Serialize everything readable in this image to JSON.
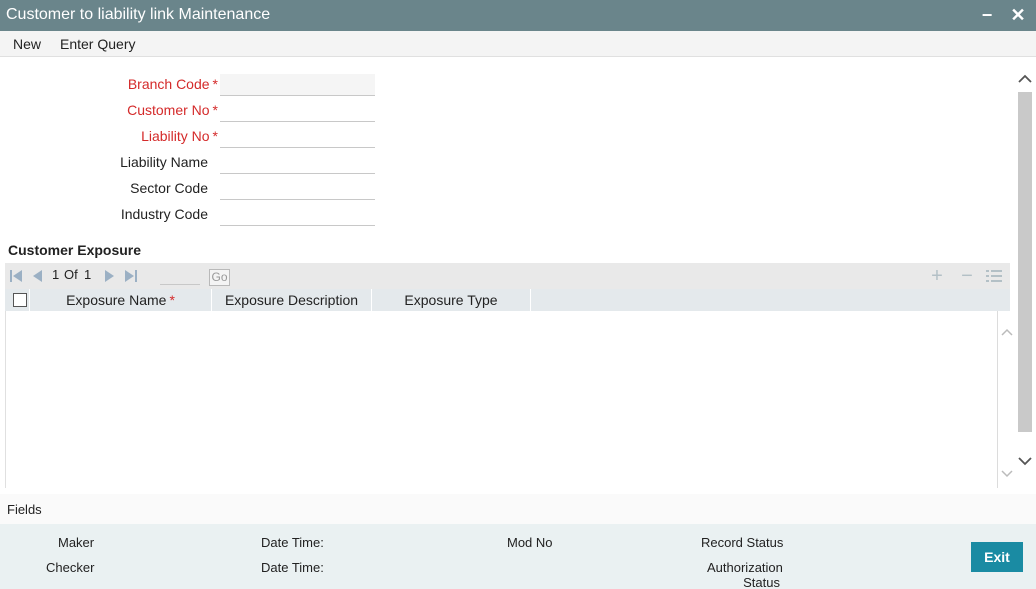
{
  "window": {
    "title": "Customer to liability link Maintenance",
    "minimize_symbol": "−",
    "close_symbol": "✕"
  },
  "menu": {
    "items": [
      "New",
      "Enter Query"
    ]
  },
  "form": {
    "required_marker": "*",
    "fields": [
      {
        "label": "Branch Code",
        "required": true,
        "value": ""
      },
      {
        "label": "Customer No",
        "required": true,
        "value": ""
      },
      {
        "label": "Liability No",
        "required": true,
        "value": ""
      },
      {
        "label": "Liability Name",
        "required": false,
        "value": ""
      },
      {
        "label": "Sector Code",
        "required": false,
        "value": ""
      },
      {
        "label": "Industry Code",
        "required": false,
        "value": ""
      }
    ]
  },
  "exposure": {
    "section_title": "Customer Exposure",
    "pagination": {
      "current": "1",
      "of_label": "Of",
      "total": "1",
      "go_label": "Go"
    },
    "columns": [
      {
        "label": "Exposure Name",
        "required": true
      },
      {
        "label": "Exposure Description",
        "required": false
      },
      {
        "label": "Exposure Type",
        "required": false
      }
    ],
    "rows": []
  },
  "footer": {
    "fields_label": "Fields",
    "maker_label": "Maker",
    "checker_label": "Checker",
    "date_time_label": "Date Time:",
    "mod_no_label": "Mod No",
    "record_status_label": "Record Status",
    "authorization_status_label_line1": "Authorization",
    "authorization_status_label_line2": "Status",
    "exit_label": "Exit"
  },
  "colors": {
    "titlebar": "#6a858b",
    "required_text": "#d42a2a",
    "exit_button": "#1a8ba3",
    "audit_background": "#eaf1f2"
  }
}
